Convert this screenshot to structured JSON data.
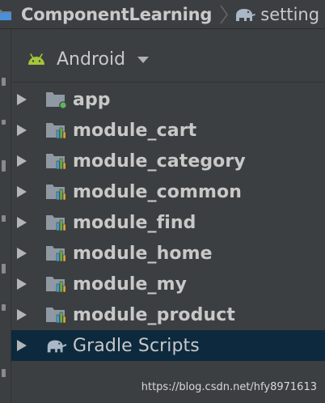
{
  "nav": {
    "project_name": "ComponentLearning",
    "file_name": "setting"
  },
  "view_selector": {
    "label": "Android"
  },
  "tree": {
    "items": [
      {
        "label": "app",
        "icon": "app-module-icon",
        "bold": true,
        "selected": false
      },
      {
        "label": "module_cart",
        "icon": "library-module-icon",
        "bold": true,
        "selected": false
      },
      {
        "label": "module_category",
        "icon": "library-module-icon",
        "bold": true,
        "selected": false
      },
      {
        "label": "module_common",
        "icon": "library-module-icon",
        "bold": true,
        "selected": false
      },
      {
        "label": "module_find",
        "icon": "library-module-icon",
        "bold": true,
        "selected": false
      },
      {
        "label": "module_home",
        "icon": "library-module-icon",
        "bold": true,
        "selected": false
      },
      {
        "label": "module_my",
        "icon": "library-module-icon",
        "bold": true,
        "selected": false
      },
      {
        "label": "module_product",
        "icon": "library-module-icon",
        "bold": true,
        "selected": false
      },
      {
        "label": "Gradle Scripts",
        "icon": "gradle-elephant-icon",
        "bold": false,
        "selected": true
      }
    ]
  },
  "watermark": "https://blog.csdn.net/hfy8971613",
  "colors": {
    "background": "#3c3f41",
    "selection": "#0d293e",
    "text": "#c8c8c8",
    "android_green": "#a4c639",
    "module_green": "#5fb35f",
    "bar_blue": "#4a9fd8",
    "bar_green": "#62b543",
    "bar_orange": "#e3a535"
  }
}
